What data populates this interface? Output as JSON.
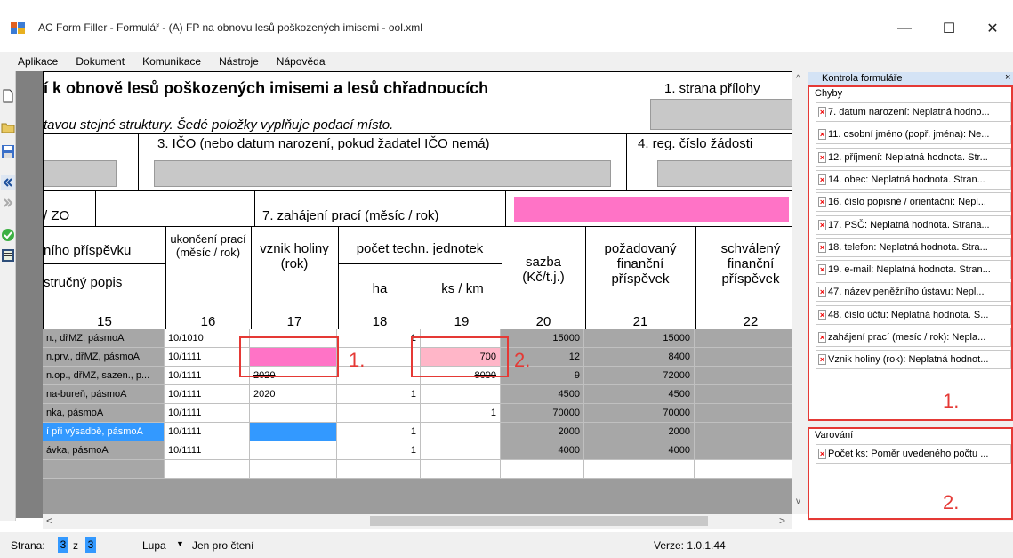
{
  "window": {
    "title": "AC Form Filler - Formulář - (A) FP na obnovu lesů poškozených imisemi - ool.xml",
    "minimize": "—",
    "maximize": "☐",
    "close": "✕"
  },
  "menu": [
    "Aplikace",
    "Dokument",
    "Komunikace",
    "Nástroje",
    "Nápověda"
  ],
  "form": {
    "heading": "í k obnově lesů poškozených imisemi a lesů chřadnoucích",
    "page_label": "1. strana přílohy",
    "subheading": "tavou stejné struktury. Šedé položky vyplňuje podací místo.",
    "ico_label": "3. IČO (nebo datum narození, pokud žadatel IČO nemá)",
    "reg_label": "4. reg. číslo žádosti",
    "zo_label": "/ ZO",
    "start_label": "7. zahájení prací (měsíc / rok)",
    "cols": {
      "prispevku": "ního příspěvku",
      "popis": "stručný popis",
      "ukonceni": "ukončení prací (měsíc / rok)",
      "vznik": "vznik holiny (rok)",
      "pocet": "počet techn. jednotek",
      "ha": "ha",
      "ks": "ks / km",
      "sazba": "sazba (Kč/t.j.)",
      "pozadovany": "požadovaný finanční příspěvek",
      "schvaleny": "schválený finanční příspěvek"
    },
    "col_numbers": [
      "15",
      "16",
      "17",
      "18",
      "19",
      "20",
      "21",
      "22"
    ]
  },
  "grid_rows": [
    {
      "popis": "n., dřMZ, pásmoA",
      "ukonceni": "10/1010",
      "vznik": "",
      "ha": "1",
      "ks": "",
      "sazba": "15000",
      "pozadovany": "15000"
    },
    {
      "popis": "n.prv., dřMZ, pásmoA",
      "ukonceni": "10/1111",
      "vznik": "",
      "ha": "",
      "ks": "700",
      "sazba": "12",
      "pozadovany": "8400"
    },
    {
      "popis": "n.op., dřMZ, sazen., p...",
      "ukonceni": "10/1111",
      "vznik": "2020",
      "ha": "",
      "ks": "8000",
      "sazba": "9",
      "pozadovany": "72000"
    },
    {
      "popis": "na-bureň, pásmoA",
      "ukonceni": "10/1111",
      "vznik": "2020",
      "ha": "1",
      "ks": "",
      "sazba": "4500",
      "pozadovany": "4500"
    },
    {
      "popis": "nka, pásmoA",
      "ukonceni": "10/1111",
      "vznik": "",
      "ha": "",
      "ks": "1",
      "sazba": "70000",
      "pozadovany": "70000"
    },
    {
      "popis": "í při výsadbě, pásmoA",
      "ukonceni": "10/1111",
      "vznik": "",
      "ha": "1",
      "ks": "",
      "sazba": "2000",
      "pozadovany": "2000"
    },
    {
      "popis": "ávka, pásmoA",
      "ukonceni": "10/1111",
      "vznik": "",
      "ha": "1",
      "ks": "",
      "sazba": "4000",
      "pozadovany": "4000"
    }
  ],
  "annotations": {
    "one": "1.",
    "two": "2."
  },
  "side": {
    "title": "Kontrola formuláře",
    "close": "×",
    "errors_header": "Chyby",
    "errors": [
      "7. datum narození: Neplatná hodno...",
      "11. osobní jméno (popř. jména): Ne...",
      "12. příjmení: Neplatná hodnota. Str...",
      "14. obec: Neplatná hodnota. Stran...",
      "16. číslo popisné / orientační: Nepl...",
      "17. PSČ: Neplatná hodnota. Strana...",
      "18. telefon: Neplatná hodnota. Stra...",
      "19. e-mail: Neplatná hodnota. Stran...",
      "47. název peněžního ústavu: Nepl...",
      "48. číslo účtu: Neplatná hodnota. S...",
      "zahájení prací (mesíc / rok): Nepla...",
      "Vznik holiny (rok): Neplatná hodnot..."
    ],
    "warnings_header": "Varování",
    "warnings": [
      "Počet ks: Poměr uvedeného počtu ..."
    ],
    "label_one": "1.",
    "label_two": "2."
  },
  "status": {
    "page_label": "Strana:",
    "page_current": "3",
    "of": "z",
    "page_total": "3",
    "zoom": "Lupa",
    "readonly": "Jen pro čtení",
    "version": "Verze: 1.0.1.44"
  }
}
